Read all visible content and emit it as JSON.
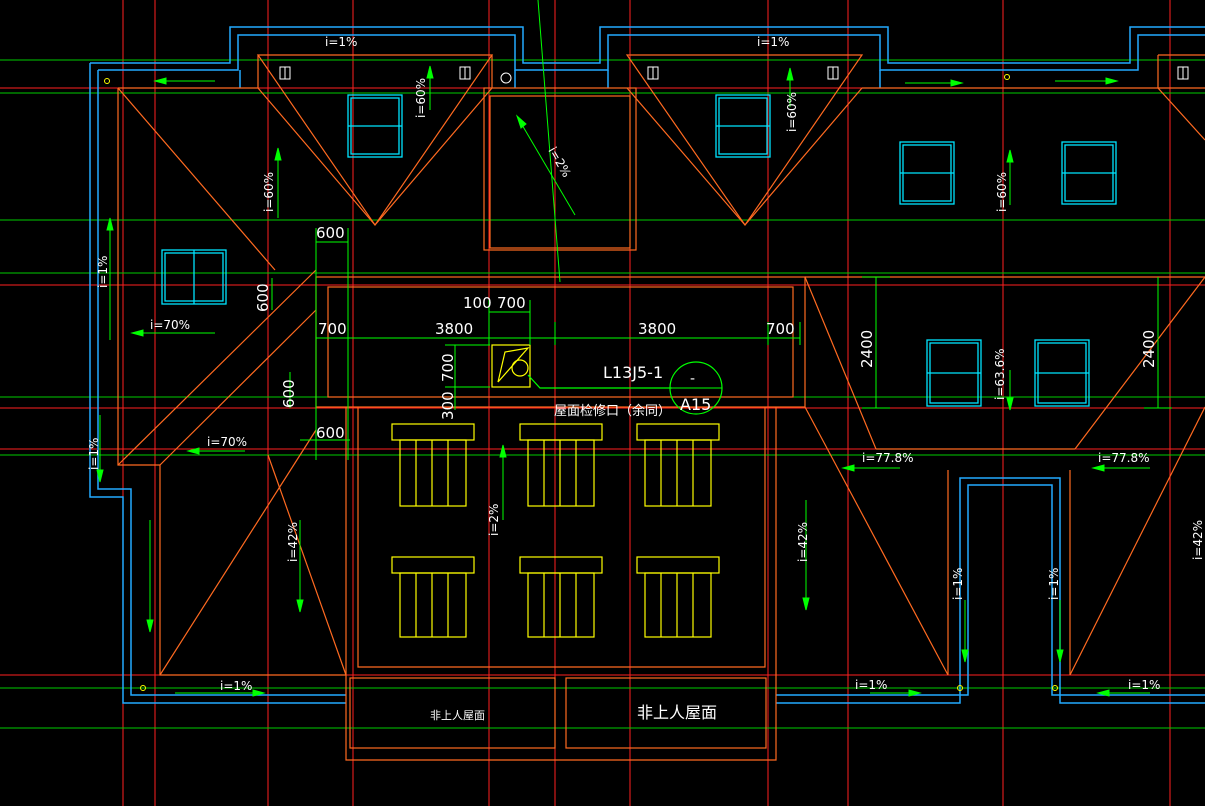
{
  "colors": {
    "background": "#000000",
    "grid_red": "#ff2020",
    "grid_green": "#00cc00",
    "wall_blue": "#22aaff",
    "roof_orange": "#ff6a20",
    "window_cyan": "#00e5ff",
    "chimney_yellow": "#ffff00",
    "text_white": "#ffffff",
    "dim_green": "#00ff00"
  },
  "slopes": {
    "top_left": "i=1%",
    "top_right": "i=1%",
    "gable1_left": "i=60%",
    "gable1_right": "i=60%",
    "gable2": "i=60%",
    "right_upper": "i=60%",
    "left_side": "i=1%",
    "left_lower": "i=1%",
    "center_upper": "i=2%",
    "left_roof_70a": "i=70%",
    "left_roof_70b": "i=70%",
    "left_42": "i=42%",
    "center_2": "i=2%",
    "right_42": "i=42%",
    "right_63": "i=63.6%",
    "right_77a": "i=77.8%",
    "right_77b": "i=77.8%",
    "right_1a": "i=1%",
    "right_1b": "i=1%",
    "far_right_42": "i=42%",
    "bottom_left": "i=1%",
    "bottom_right_a": "i=1%",
    "bottom_right_b": "i=1%"
  },
  "dimensions": {
    "d600_top": "600",
    "d600_left": "600",
    "d600_mid": "600",
    "d600_low": "600",
    "d100": "100",
    "d700_top": "700",
    "d700_left": "700",
    "d3800_left": "3800",
    "d3800_right": "3800",
    "d700_right": "700",
    "d700_vert": "700",
    "d300_vert": "300",
    "d2400_a": "2400",
    "d2400_b": "2400"
  },
  "labels": {
    "detail_ref": "L13J5-1",
    "detail_circle_top": "-",
    "detail_circle_bottom": "A15",
    "hatch_note": "屋面检修口（余同）",
    "roof_small": "非上人屋面",
    "roof_large": "非上人屋面"
  }
}
